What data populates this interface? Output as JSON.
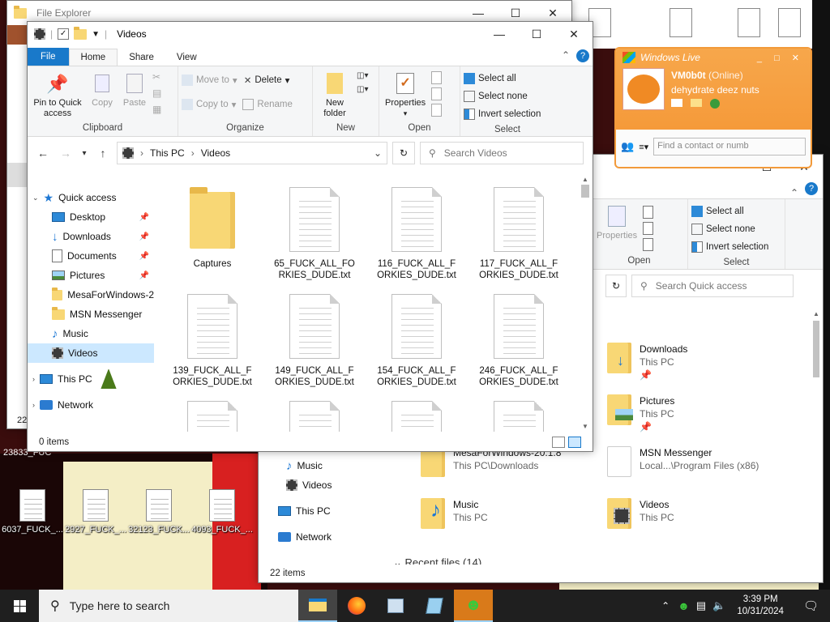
{
  "desktop": {
    "icons": [
      {
        "label": "6037_FUCK_..."
      },
      {
        "label": "2927_FUCK_..."
      },
      {
        "label": "32123_FUCK..."
      },
      {
        "label": "4093_FUCK_..."
      }
    ],
    "left_fragment": "23833_FUC"
  },
  "back_explorer": {
    "title": "File Explorer",
    "status_prefix": "22"
  },
  "main_window": {
    "title": "Videos",
    "tabs": [
      "File",
      "Home",
      "Share",
      "View"
    ],
    "ribbon": {
      "clipboard": {
        "label": "Clipboard",
        "pin": "Pin to Quick access",
        "copy": "Copy",
        "paste": "Paste"
      },
      "organize": {
        "label": "Organize",
        "move_to": "Move to",
        "copy_to": "Copy to",
        "delete": "Delete",
        "rename": "Rename"
      },
      "new": {
        "label": "New",
        "new_folder": "New folder"
      },
      "open": {
        "label": "Open",
        "properties": "Properties"
      },
      "select": {
        "label": "Select",
        "select_all": "Select all",
        "select_none": "Select none",
        "invert": "Invert selection"
      }
    },
    "address": {
      "crumb1": "This PC",
      "crumb2": "Videos"
    },
    "search_placeholder": "Search Videos",
    "nav": {
      "quick_access": "Quick access",
      "items": [
        {
          "label": "Desktop",
          "pinned": true
        },
        {
          "label": "Downloads",
          "pinned": true
        },
        {
          "label": "Documents",
          "pinned": true
        },
        {
          "label": "Pictures",
          "pinned": true
        },
        {
          "label": "MesaForWindows-2"
        },
        {
          "label": "MSN Messenger"
        },
        {
          "label": "Music"
        },
        {
          "label": "Videos"
        }
      ],
      "this_pc": "This PC",
      "network": "Network"
    },
    "files": [
      {
        "name": "Captures"
      },
      {
        "name": "65_FUCK_ALL_FORKIES_DUDE.txt"
      },
      {
        "name": "116_FUCK_ALL_FORKIES_DUDE.txt"
      },
      {
        "name": "117_FUCK_ALL_FORKIES_DUDE.txt"
      },
      {
        "name": "139_FUCK_ALL_FORKIES_DUDE.txt"
      },
      {
        "name": "149_FUCK_ALL_FORKIES_DUDE.txt"
      },
      {
        "name": "154_FUCK_ALL_FORKIES_DUDE.txt"
      },
      {
        "name": "246_FUCK_ALL_FORKIES_DUDE.txt"
      }
    ],
    "status": "0 items"
  },
  "second_window": {
    "ribbon": {
      "properties": "Properties",
      "open_label": "Open",
      "select_all": "Select all",
      "select_none": "Select none",
      "invert": "Invert selection",
      "select_label": "Select"
    },
    "search_placeholder": "Search Quick access",
    "nav": [
      {
        "label": "Music"
      },
      {
        "label": "Videos"
      },
      {
        "label": "This PC"
      },
      {
        "label": "Network"
      }
    ],
    "quick_items": [
      {
        "name": "Downloads",
        "sub": "This PC"
      },
      {
        "name": "Pictures",
        "sub": "This PC"
      },
      {
        "name": "MesaForWindows-20.1.8",
        "sub": "This PC\\Downloads"
      },
      {
        "name": "MSN Messenger",
        "sub": "Local...\\Program Files (x86)"
      },
      {
        "name": "Music",
        "sub": "This PC"
      },
      {
        "name": "Videos",
        "sub": "This PC"
      }
    ],
    "recent": "Recent files (14)",
    "status": "22 items"
  },
  "messenger": {
    "title": "Windows Live",
    "username": "VM0b0t",
    "status": "(Online)",
    "message": "dehydrate deez nuts",
    "search_placeholder": "Find a contact or numb"
  },
  "taskbar": {
    "search_placeholder": "Type here to search",
    "time": "3:39 PM",
    "date": "10/31/2024"
  }
}
